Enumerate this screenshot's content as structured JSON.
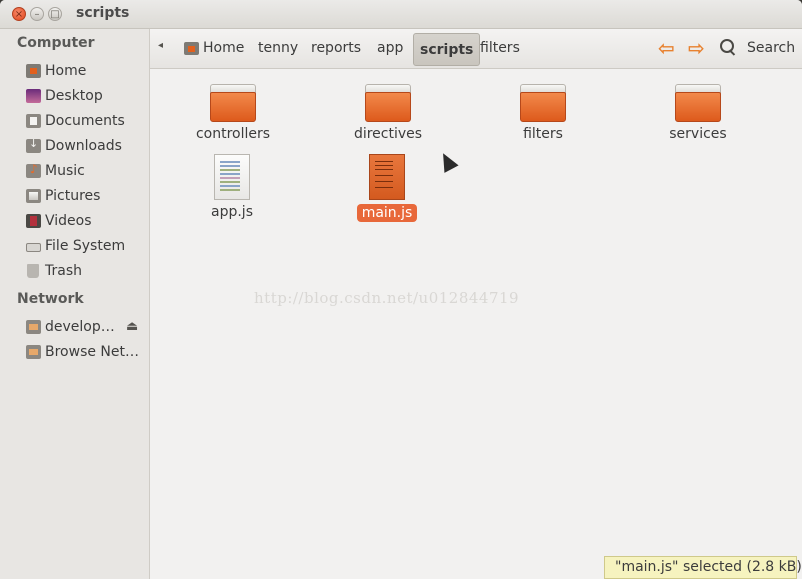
{
  "window": {
    "title": "scripts"
  },
  "sidebar": {
    "computer_heading": "Computer",
    "network_heading": "Network",
    "items": [
      {
        "label": "Home",
        "icon": "home-folder-icon"
      },
      {
        "label": "Desktop",
        "icon": "desktop-icon"
      },
      {
        "label": "Documents",
        "icon": "documents-icon"
      },
      {
        "label": "Downloads",
        "icon": "downloads-icon"
      },
      {
        "label": "Music",
        "icon": "music-icon"
      },
      {
        "label": "Pictures",
        "icon": "pictures-icon"
      },
      {
        "label": "Videos",
        "icon": "videos-icon"
      },
      {
        "label": "File System",
        "icon": "drive-icon"
      },
      {
        "label": "Trash",
        "icon": "trash-icon"
      }
    ],
    "network_items": [
      {
        "label": "develop…",
        "icon": "network-share-icon"
      },
      {
        "label": "Browse Net…",
        "icon": "network-icon"
      }
    ]
  },
  "toolbar": {
    "breadcrumbs": [
      "Home",
      "tenny",
      "reports",
      "app",
      "scripts",
      "filters"
    ],
    "search_label": "Search"
  },
  "files": [
    {
      "name": "controllers",
      "type": "folder"
    },
    {
      "name": "directives",
      "type": "folder"
    },
    {
      "name": "filters",
      "type": "folder"
    },
    {
      "name": "services",
      "type": "folder"
    },
    {
      "name": "app.js",
      "type": "text-file"
    },
    {
      "name": "main.js",
      "type": "js-file",
      "selected": true
    }
  ],
  "watermark": "http://blog.csdn.net/u012844719",
  "status": "\"main.js\" selected (2.8 kB)",
  "colors": {
    "accent": "#e8683a",
    "folder": "#e8773d",
    "status_bg": "#f6f3bf"
  }
}
